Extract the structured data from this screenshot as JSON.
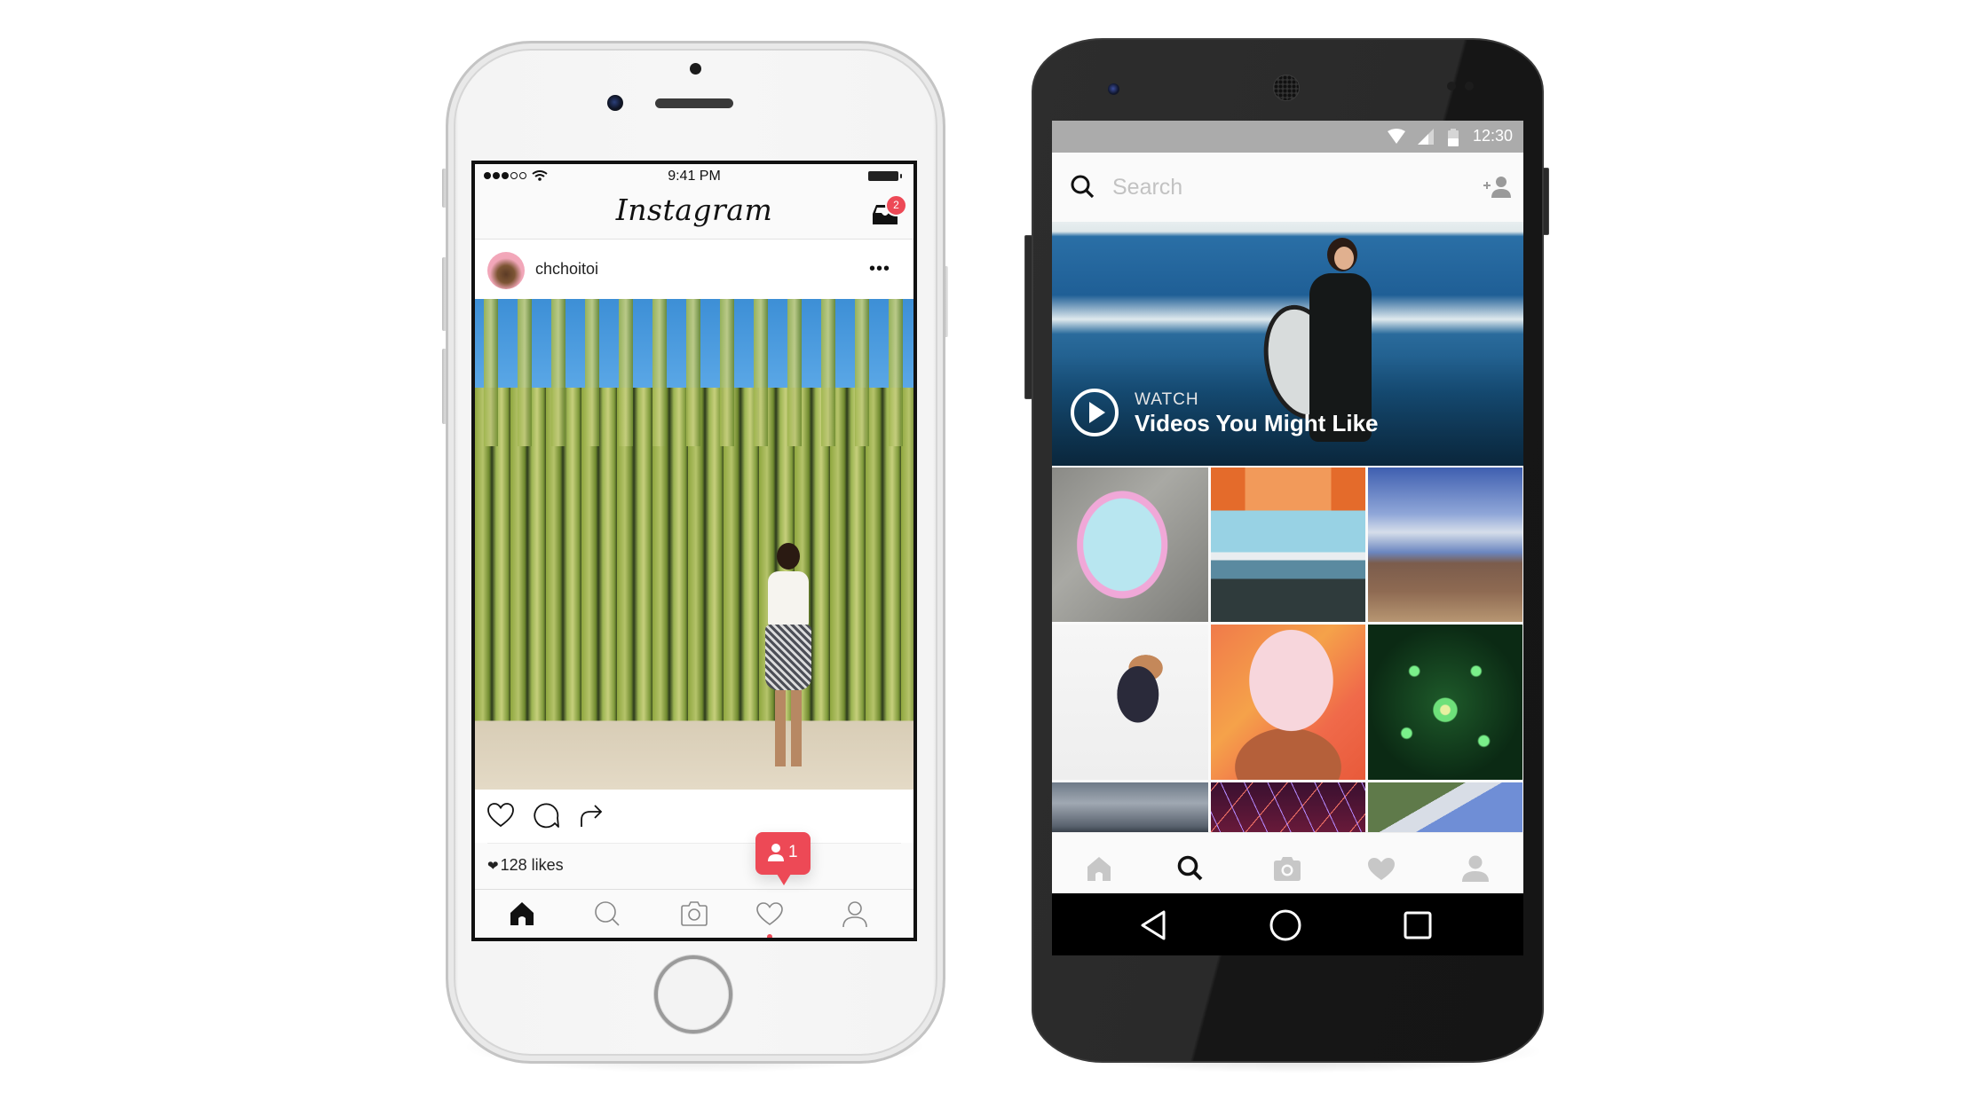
{
  "ios": {
    "status_bar": {
      "signal_bars_filled": 3,
      "signal_bars_total": 5,
      "time": "9:41 PM",
      "battery": "full"
    },
    "nav": {
      "logo": "Instagram",
      "inbox_icon": "inbox-icon",
      "inbox_badge": "2"
    },
    "post": {
      "username": "chchoitoi",
      "more_label": "•••",
      "likes": "128 likes",
      "actions": [
        "like-icon",
        "comment-icon",
        "share-icon"
      ]
    },
    "notification": {
      "icon": "follower-icon",
      "count": "1"
    },
    "tabbar": {
      "items": [
        {
          "name": "home",
          "active": true
        },
        {
          "name": "search",
          "active": false
        },
        {
          "name": "camera",
          "active": false
        },
        {
          "name": "activity",
          "active": false,
          "has_dot": true
        },
        {
          "name": "profile",
          "active": false
        }
      ]
    }
  },
  "android": {
    "status_bar": {
      "time": "12:30",
      "icons": [
        "wifi-icon",
        "cell-signal-icon",
        "battery-icon"
      ]
    },
    "search": {
      "placeholder": "Search",
      "value": "",
      "add_person_icon": "add-person-icon"
    },
    "banner": {
      "label": "WATCH",
      "title": "Videos You Might Like"
    },
    "grid": {
      "tiles": [
        "cat-in-mirror",
        "tent-ocean-view",
        "canyon-kneeling",
        "dog-lifted",
        "cotton-candy",
        "green-fireworks",
        "cloudy-sky",
        "light-trails",
        "snowy-mountain"
      ]
    },
    "tabbar": {
      "items": [
        {
          "name": "home",
          "active": false
        },
        {
          "name": "search",
          "active": true
        },
        {
          "name": "camera",
          "active": false
        },
        {
          "name": "activity",
          "active": false
        },
        {
          "name": "profile",
          "active": false
        }
      ]
    },
    "system_nav": [
      "back",
      "home",
      "recents"
    ]
  },
  "colors": {
    "accent_red": "#ed4956",
    "android_status_gray": "#ababab",
    "icon_inactive_gray": "#c7c7c7"
  }
}
